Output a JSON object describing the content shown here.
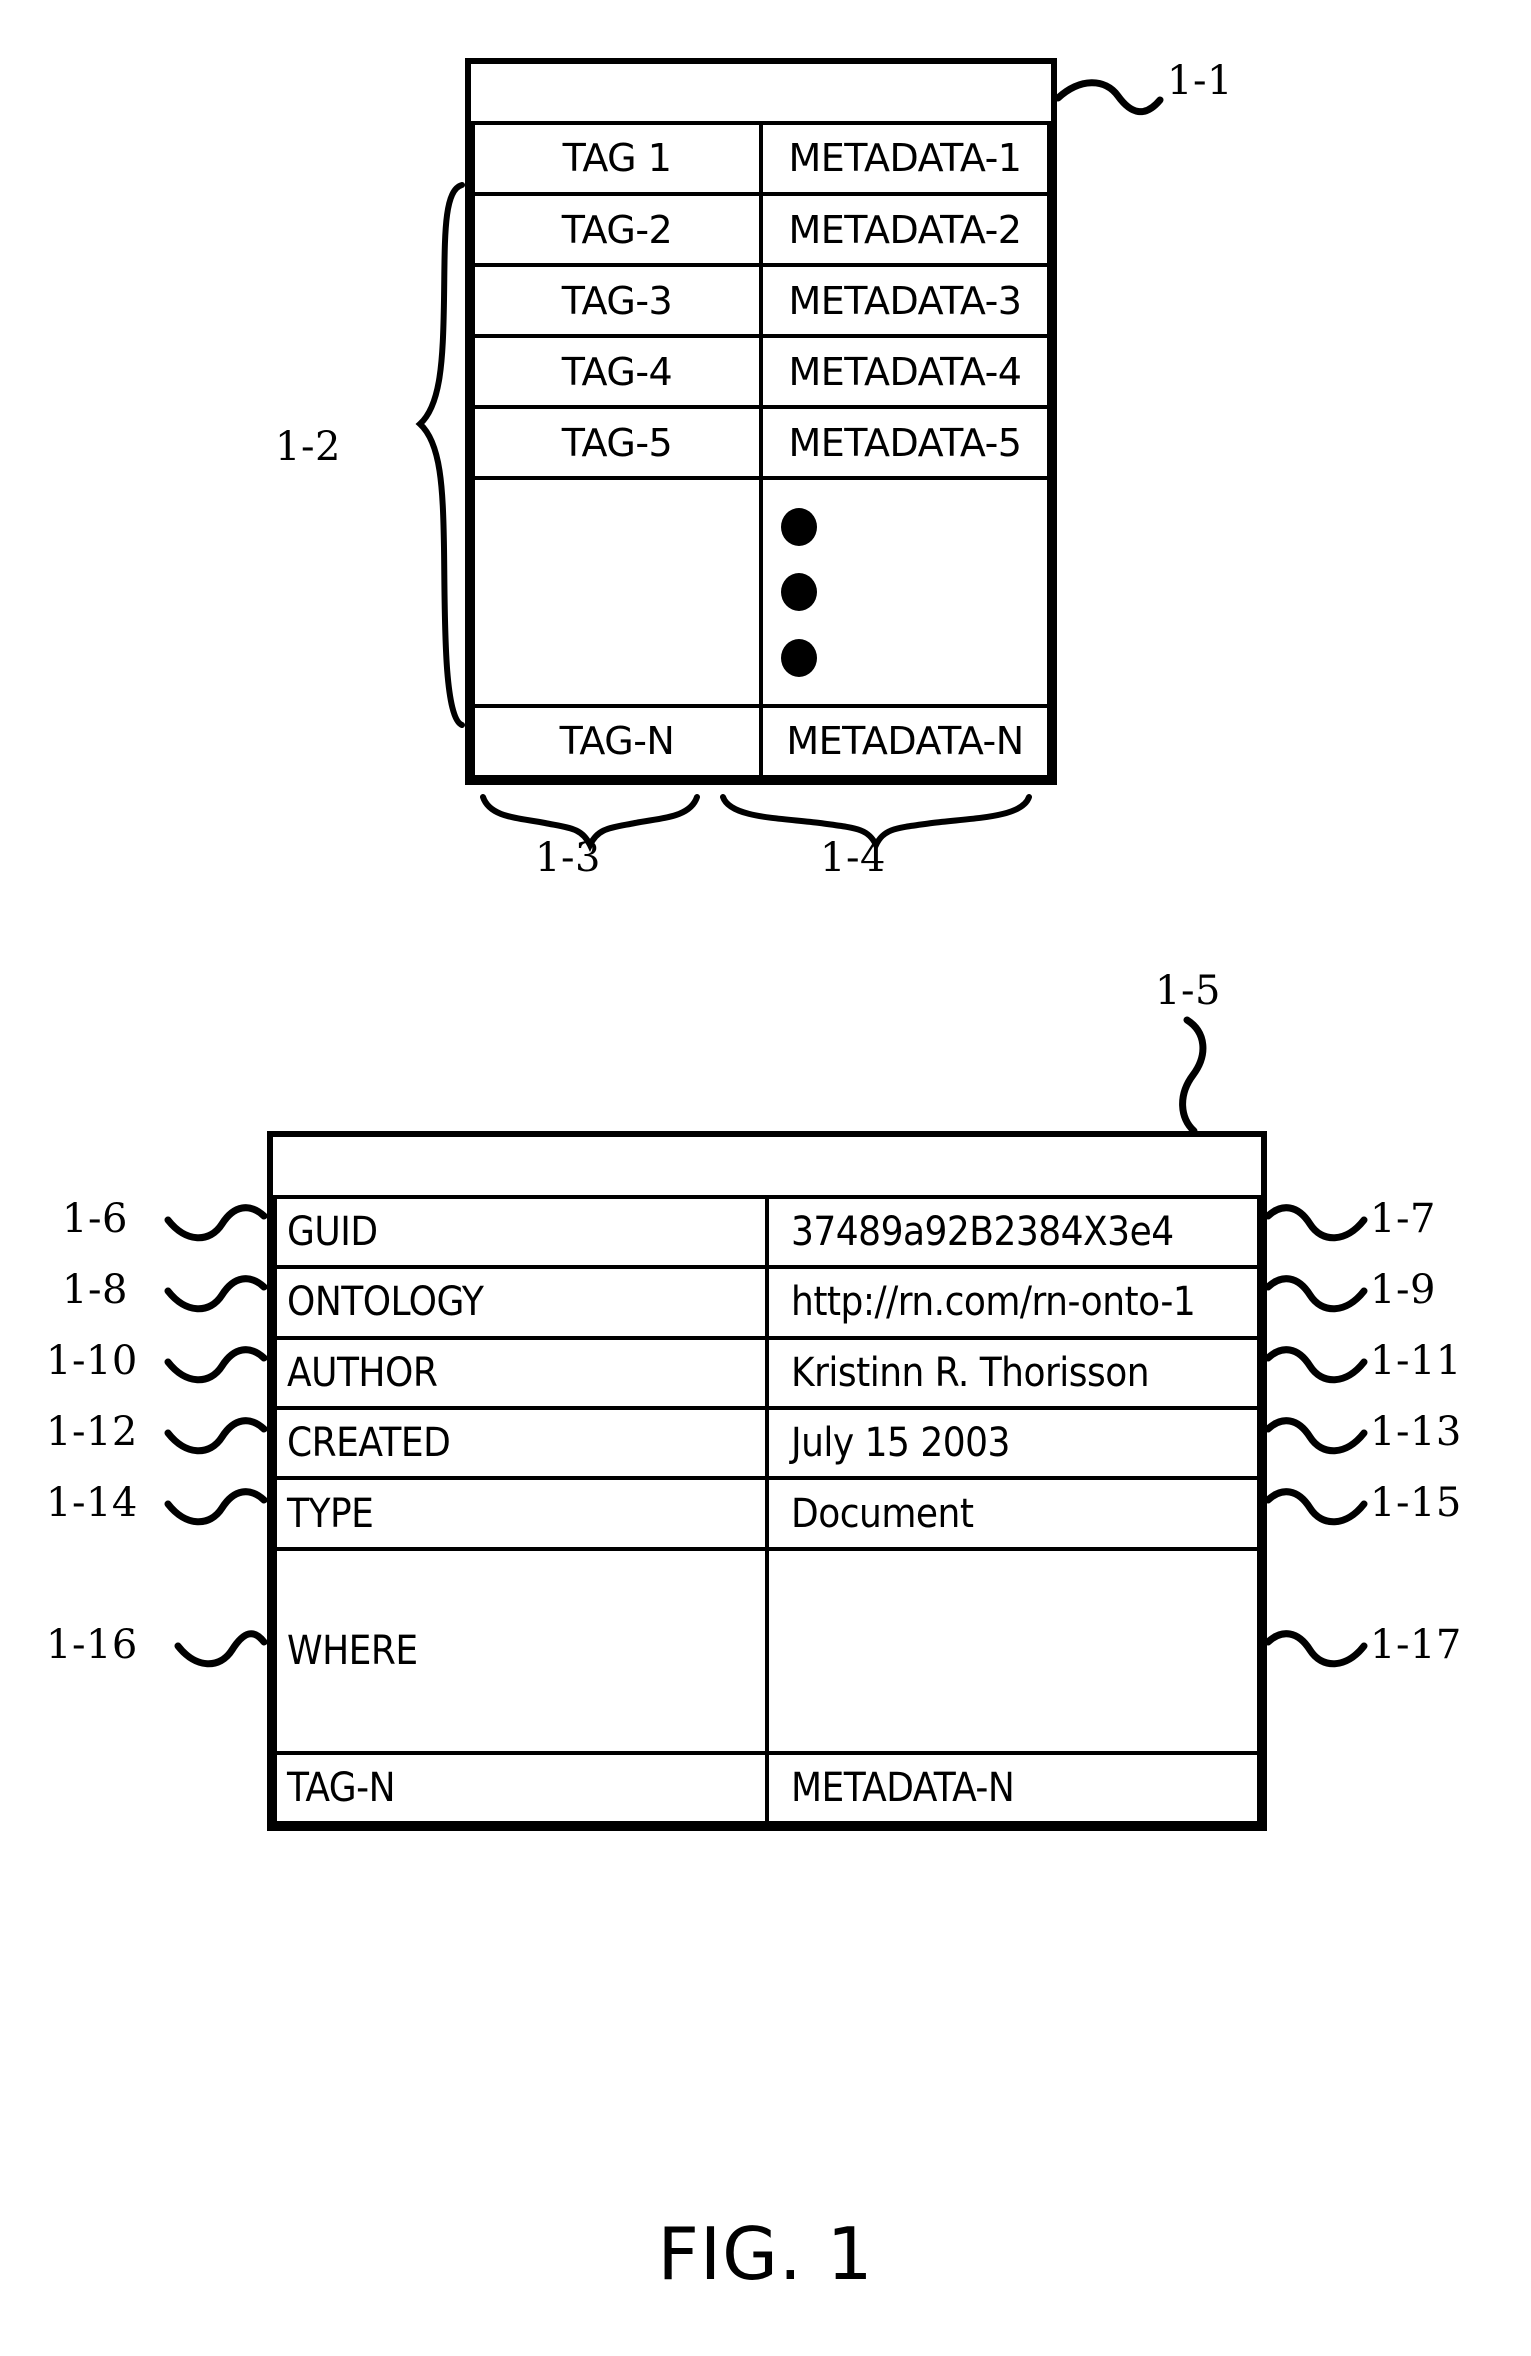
{
  "figure": {
    "caption": "FIG. 1"
  },
  "table_1": {
    "ref_label": "1-1",
    "group_label": "1-2",
    "column_label_left": "1-3",
    "column_label_right": "1-4",
    "header_row": {
      "left": "",
      "right": ""
    },
    "rows": [
      {
        "tag": "TAG 1",
        "metadata": "METADATA-1"
      },
      {
        "tag": "TAG-2",
        "metadata": "METADATA-2"
      },
      {
        "tag": "TAG-3",
        "metadata": "METADATA-3"
      },
      {
        "tag": "TAG-4",
        "metadata": "METADATA-4"
      },
      {
        "tag": "TAG-5",
        "metadata": "METADATA-5"
      }
    ],
    "ellipsis_row": {
      "tag": "",
      "metadata_dots": 3
    },
    "last_row": {
      "tag": "TAG-N",
      "metadata": "METADATA-N"
    }
  },
  "table_2": {
    "ref_label": "1-5",
    "header_row": {
      "left": "",
      "right": ""
    },
    "rows": [
      {
        "key": "GUID",
        "value": "37489a92B2384X3e4",
        "key_ref": "1-6",
        "value_ref": "1-7"
      },
      {
        "key": "ONTOLOGY",
        "value": "http://rn.com/rn-onto-1",
        "key_ref": "1-8",
        "value_ref": "1-9"
      },
      {
        "key": "AUTHOR",
        "value": "Kristinn R. Thorisson",
        "key_ref": "1-10",
        "value_ref": "1-11"
      },
      {
        "key": "CREATED",
        "value": "July 15 2003",
        "key_ref": "1-12",
        "value_ref": "1-13"
      },
      {
        "key": "TYPE",
        "value": "Document",
        "key_ref": "1-14",
        "value_ref": "1-15"
      },
      {
        "key": "WHERE",
        "value": "",
        "key_ref": "1-16",
        "value_ref": "1-17"
      }
    ],
    "last_row": {
      "key": "TAG-N",
      "value": "METADATA-N"
    }
  },
  "colors": {
    "ink": "#000000",
    "paper": "#ffffff"
  }
}
